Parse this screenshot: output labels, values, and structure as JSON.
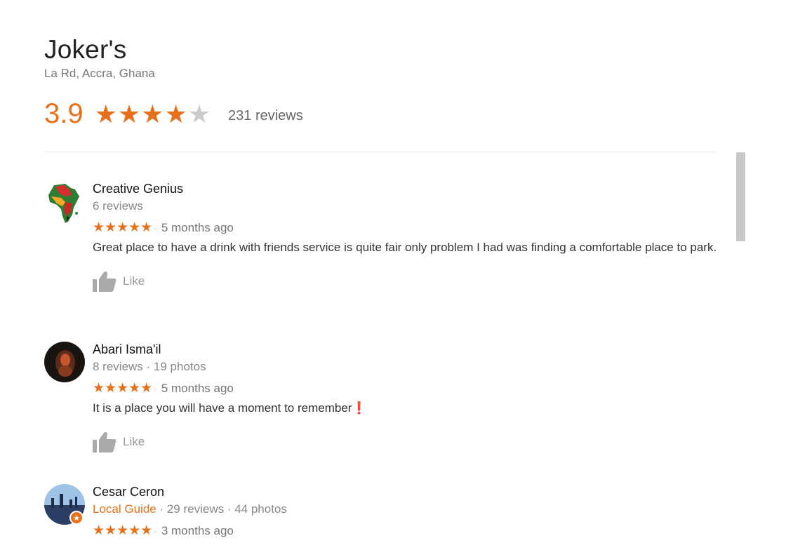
{
  "place": {
    "title": "Joker's",
    "address": "La Rd, Accra, Ghana",
    "rating": "3.9",
    "rating_value": 3.9,
    "stars_filled": 4,
    "stars_total": 5,
    "review_count": "231 reviews"
  },
  "colors": {
    "accent": "#e7711b",
    "muted": "#888888"
  },
  "reviews": [
    {
      "author": "Creative Genius",
      "meta": "6 reviews",
      "stars": 5,
      "time": "5 months ago",
      "text": "Great place to have a drink with friends service is quite fair only problem I had was finding a comfortable place to park.",
      "like_label": "Like",
      "avatar_icon": "africa-map-avatar"
    },
    {
      "author": "Abari Isma'il",
      "meta": "8 reviews · 19 photos",
      "stars": 5,
      "time": "5 months ago",
      "text": "It is a place you will have a moment to remember❗",
      "like_label": "Like",
      "avatar_icon": "person-photo-avatar"
    },
    {
      "author": "Cesar Ceron",
      "guide": "Local Guide",
      "meta": " · 29 reviews · 44 photos",
      "stars": 5,
      "time": "3 months ago",
      "avatar_icon": "cityscape-avatar"
    }
  ]
}
